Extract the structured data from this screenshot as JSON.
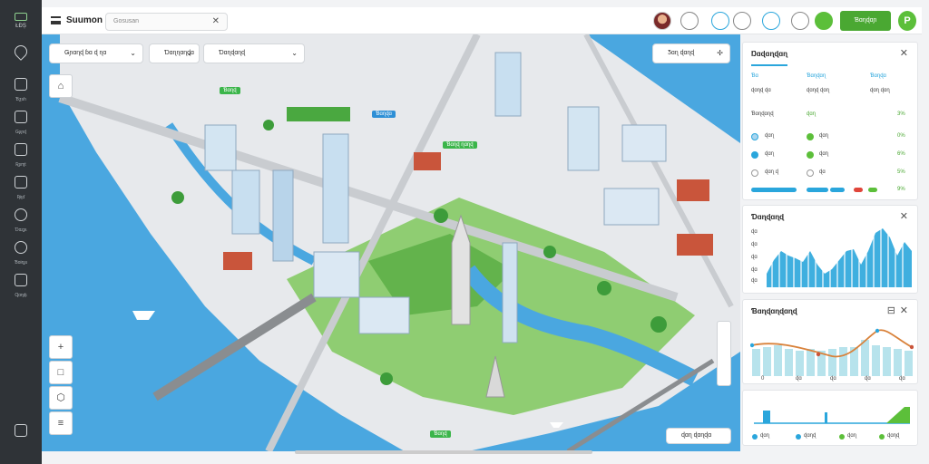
{
  "app": {
    "title": "Suumon",
    "logo_text": "ŁĐȘ"
  },
  "search": {
    "placeholder": "Gosusan",
    "clear_icon": "close-icon"
  },
  "leftbar": {
    "items": [
      {
        "icon": "pin-icon",
        "label": ""
      },
      {
        "icon": "layers-icon",
        "label": "Ɓƺsh"
      },
      {
        "icon": "document-icon",
        "label": "Ǥʂɲɖ"
      },
      {
        "icon": "flag-icon",
        "label": "Ʀʂɱt"
      },
      {
        "icon": "grid-icon",
        "label": "Ʀɨʅɗ"
      },
      {
        "icon": "play-icon",
        "label": "Ɗɑʐʂɩ"
      },
      {
        "icon": "settings-icon",
        "label": "Ɓɑɨɳʂɩ"
      },
      {
        "icon": "user-icon",
        "label": "Ɋɑɳɖɩ"
      }
    ]
  },
  "topbar": {
    "primary_button": "Ɓɑɳɖɑɲ"
  },
  "filters": [
    {
      "label": "Ǥɲɑɳɖ ɓɑ ɖ ɳɑ"
    },
    {
      "label": "Ɗɑɳɳɑɳɖɑ"
    },
    {
      "label": "Ɗɑɳɖɑɳɖ"
    }
  ],
  "map_toolbar": {
    "label": "Ƽɑɳ ɖɑɳɖ"
  },
  "map_tags": [
    {
      "text": "Ɓɑɳɖ",
      "color": "#3bb54a"
    },
    {
      "text": "Ɓɑɳɖɑ",
      "color": "#2d8fd6"
    },
    {
      "text": "Ɓɑɳɖ ɳɑɳɖ",
      "color": "#3bb54a"
    }
  ],
  "map_bottom_label": "ɖɑɳ ɖɑɳɖɑ",
  "map_bottom_tag": "Ɓɑɳɖ",
  "panel_stats": {
    "title": "Ŋɑɖɑɳɖɑɳ",
    "headers": [
      "Ɓɑ",
      "Ɓɑɳɖɑɳ",
      "Ɓɑɳɖɑ"
    ],
    "subheaders": [
      "ɖɑɳɖ ɖɑ",
      "ɖɑɳɖ ɖɑɳ",
      "ɖɑɳ ɖɑɳ"
    ],
    "section": "Ɓɑɳɖɑɳɖ",
    "section_value": "ɖɑɳ",
    "section_pct": "3%",
    "rows": [
      {
        "a": "ɖɑɳ",
        "b": "ɖɑɳ",
        "pct": "0%",
        "color_a": "#a8d5ef",
        "color_b": "#5cbf3a"
      },
      {
        "a": "ɖɑɳ",
        "b": "ɖɑɳ",
        "pct": "6%",
        "color_a": "#2aa6dc",
        "color_b": "#5cbf3a"
      },
      {
        "a": "ɖɑɳ ɖ",
        "b": "ɖɑ",
        "pct": "5%",
        "color_a": "#ffffff",
        "color_b": "#ffffff"
      }
    ],
    "bar_pct": "9%"
  },
  "panel_bars": {
    "title": "Ɗɑɳɖɑɳɖ",
    "y_labels": [
      "ɖɑ",
      "ɖɑ",
      "ɖɑ",
      "ɖɑ",
      "ɖɑ"
    ]
  },
  "panel_lines": {
    "title": "Ɓɑɳɖɑɳɖɑɳɖ",
    "x_labels": [
      "0",
      "ɖɑ",
      "ɖɑ",
      "ɖɑ",
      "ɖɑ"
    ]
  },
  "panel_small": {
    "legend": [
      "ɖɑɳ",
      "ɖɑɳɖ",
      "ɖɑɳ",
      "ɖɑɳɖ"
    ],
    "colors": [
      "#2aa6dc",
      "#2aa6dc",
      "#5cbf3a",
      "#5cbf3a"
    ]
  },
  "colors": {
    "accent_green": "#4aa832",
    "accent_blue": "#2aa6dc",
    "water": "#4aa7e0",
    "sidebar": "#2f3337"
  }
}
